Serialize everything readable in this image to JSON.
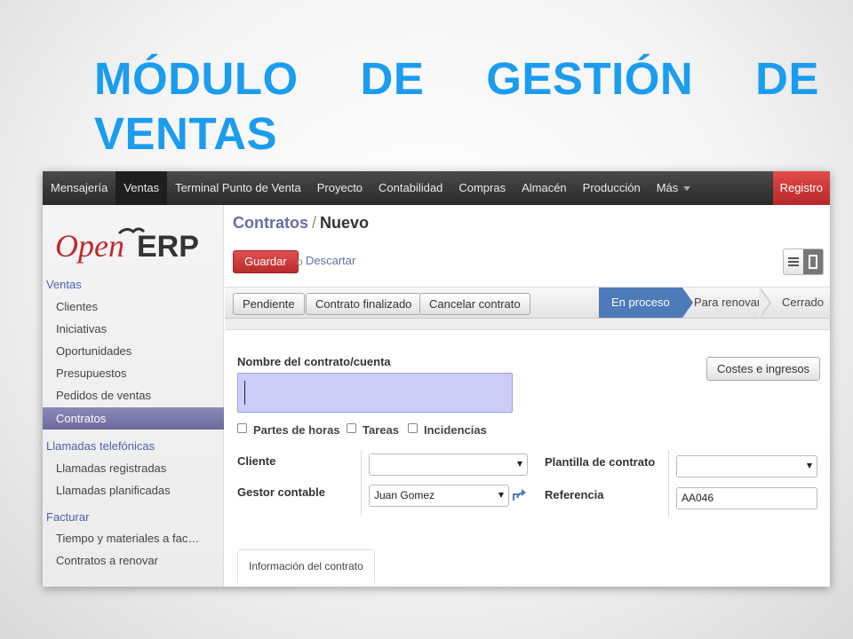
{
  "slide": {
    "title_line1": [
      "MÓDULO",
      "DE",
      "GESTIÓN",
      "DE"
    ],
    "title_line2": "VENTAS"
  },
  "topbar": {
    "items": [
      "Mensajería",
      "Ventas",
      "Terminal Punto de Venta",
      "Proyecto",
      "Contabilidad",
      "Compras",
      "Almacén",
      "Producción",
      "Más"
    ],
    "active_item": "Ventas",
    "login_label": "Registro"
  },
  "sidebar": {
    "logo_left": "Open",
    "logo_right": "ERP",
    "sections": [
      {
        "title": "Ventas",
        "items": [
          "Clientes",
          "Iniciativas",
          "Oportunidades",
          "Presupuestos",
          "Pedidos de ventas",
          "Contratos"
        ]
      },
      {
        "title": "Llamadas telefónicas",
        "items": [
          "Llamadas registradas",
          "Llamadas planificadas"
        ]
      },
      {
        "title": "Facturar",
        "items": [
          "Tiempo y materiales a fac…",
          "Contratos a renovar"
        ]
      }
    ],
    "selected_item": "Contratos"
  },
  "header": {
    "breadcrumb_parent": "Contratos",
    "breadcrumb_sep": "/",
    "breadcrumb_current": "Nuevo",
    "save_label": "Guardar",
    "or_label": "o",
    "discard_label": "Descartar"
  },
  "statusbar": {
    "buttons": [
      "Pendiente",
      "Contrato finalizado",
      "Cancelar contrato"
    ],
    "stages": [
      "En proceso",
      "Para renovar",
      "Cerrado"
    ],
    "current_stage": "En proceso"
  },
  "form": {
    "name_label": "Nombre del contrato/cuenta",
    "name_value": "",
    "costs_button": "Costes e ingresos",
    "checkboxes": [
      "Partes de horas",
      "Tareas",
      "Incidencias"
    ],
    "client_label": "Cliente",
    "client_value": "",
    "manager_label": "Gestor contable",
    "manager_value": "Juan Gomez",
    "template_label": "Plantilla de contrato",
    "template_value": "",
    "reference_label": "Referencia",
    "reference_value": "AA046",
    "tab_label": "Información del contrato"
  },
  "colors": {
    "title_blue": "#1a9cf0",
    "save_red": "#c93636",
    "stage_blue": "#4d7ab8",
    "sidebar_selected": "#7574a8",
    "link_purple": "#6b6ba4"
  }
}
